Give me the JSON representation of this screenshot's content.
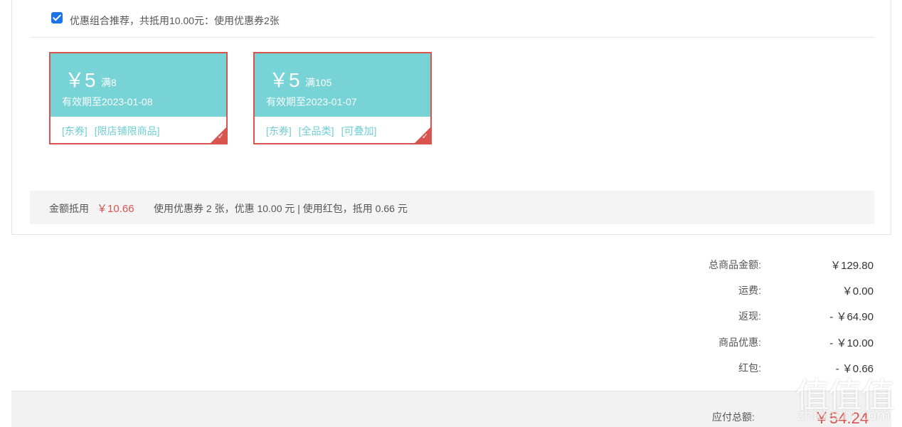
{
  "combo": {
    "checked": true,
    "text": "优惠组合推荐，共抵用10.00元：使用优惠券2张"
  },
  "coupons": [
    {
      "amount": "￥5",
      "condition": "满8",
      "valid": "有效期至2023-01-08",
      "tags": [
        "[东券]",
        "[限店铺限商品]"
      ],
      "selected": true
    },
    {
      "amount": "￥5",
      "condition": "满105",
      "valid": "有效期至2023-01-07",
      "tags": [
        "[东券]",
        "[全品类]",
        "[可叠加]"
      ],
      "selected": true
    }
  ],
  "summary": {
    "label": "金额抵用",
    "amount": "￥10.66",
    "desc": "使用优惠券 2 张，优惠 10.00 元  | 使用红包，抵用 0.66 元"
  },
  "totals": [
    {
      "label": "总商品金额:",
      "value": "￥129.80"
    },
    {
      "label": "运费:",
      "value": "￥0.00"
    },
    {
      "label": "返现:",
      "value": "- ￥64.90"
    },
    {
      "label": "商品优惠:",
      "value": "- ￥10.00"
    },
    {
      "label": "红包:",
      "value": "- ￥0.66"
    }
  ],
  "pay": {
    "label": "应付总额:",
    "value": "￥54.24"
  },
  "watermark": {
    "big": "值值值",
    "small": "zhidezhi.com"
  },
  "colors": {
    "coupon_bg": "#78d3d6",
    "coupon_border": "#d9534f",
    "price_red": "#d9534f",
    "checkbox": "#1a73e8"
  }
}
